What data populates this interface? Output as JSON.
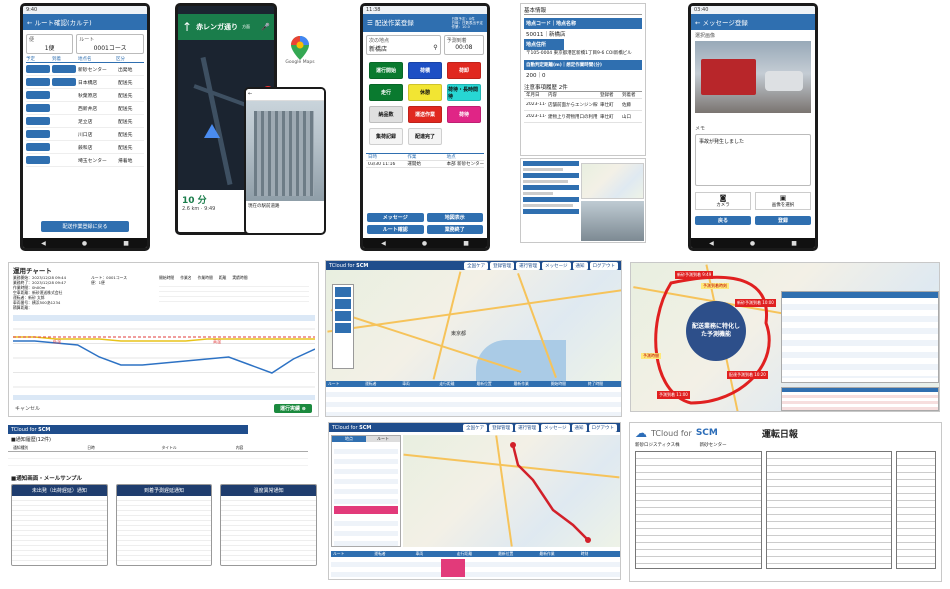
{
  "route_phone": {
    "time": "9:40",
    "title": "ルート確認(カルテ)",
    "bin_label": "便",
    "bin_value": "1便",
    "route_label": "ルート",
    "route_value": "0001コース",
    "col_headers": [
      "予定",
      "到着",
      "地点名",
      "区分"
    ],
    "rows": [
      [
        "新砂センター",
        "出発地"
      ],
      [
        "日本橋店",
        "配送先"
      ],
      [
        "秋葉原店",
        "配送先"
      ],
      [
        "西新井店",
        "配送先"
      ],
      [
        "足立店",
        "配送先"
      ],
      [
        "川口店",
        "配送先"
      ],
      [
        "蕨和店",
        "配送先"
      ],
      [
        "埼玉センター",
        "帰着地"
      ]
    ],
    "return_button": "配送作業登録に戻る"
  },
  "nav_phone": {
    "street": "赤レンガ通り",
    "street_suffix": "方面",
    "eta_minutes": "10 分",
    "distance": "2.6 km · 9:49",
    "dest_label": "現在の駅前道路",
    "google_maps": "Google Maps"
  },
  "work_phone": {
    "time": "11:38",
    "title": "配送作業登録",
    "info": [
      "日数予定：0件",
      "日時：日数表出予定",
      "作業：10.0"
    ],
    "next_point_label": "次の地点",
    "next_point_value": "新橋店",
    "arrival_label": "予測到着",
    "arrival_value": "00:08",
    "buttons": [
      {
        "label": "運行開始",
        "bg": "#0a7a2f"
      },
      {
        "label": "荷積",
        "bg": "#1d4fc4"
      },
      {
        "label": "荷卸",
        "bg": "#e0281f"
      },
      {
        "label": "走行",
        "bg": "#0a7a2f"
      },
      {
        "label": "休憩",
        "bg": "#f2e533"
      },
      {
        "label": "荷待・長時間待",
        "bg": "#27d6d3"
      },
      {
        "label": "納品数",
        "bg": "#e0e0e0"
      },
      {
        "label": "運送作業",
        "bg": "#e0281f"
      },
      {
        "label": "荷待",
        "bg": "#e02586"
      },
      {
        "label": "集荷記録",
        "bg": "#f4f4f4"
      },
      {
        "label": "配達完了",
        "bg": "#f4f4f4"
      }
    ],
    "log_headers": [
      "日時",
      "作業",
      "地点"
    ],
    "log_row": [
      "03/30 11:16",
      "運開始",
      "本部 新砂センター"
    ],
    "bottom_buttons": [
      "メッセージ",
      "地図表示",
      "ルート確認",
      "業務終了"
    ]
  },
  "point_panel": {
    "section": "基本情報",
    "code_label": "地点コード｜地点名称",
    "code_value": "50011｜新橋店",
    "addr_label": "地点住所",
    "addr_value": "〒105-0004 東京都港区新橋1丁目9-6 COI新橋ビル",
    "dist_label": "自動判定距離(m)｜想定作業時間(分)",
    "dist_value": "200｜0",
    "history_label": "注意事項履歴 2件",
    "history_headers": [
      "年月日",
      "内容",
      "登録者",
      "到着者"
    ],
    "history_rows": [
      [
        "2023-11-",
        "店舗前面からエンジン稼働停止要",
        "車仕町",
        "佐藤"
      ],
      [
        "2023-11-",
        "建物上り荷物用口の利用法",
        "車仕町",
        "山口"
      ]
    ]
  },
  "msg_phone": {
    "time": "03:40",
    "title": "メッセージ登録",
    "image_label": "選択画像",
    "memo_label": "メモ",
    "memo_text": "事故が発生しました",
    "camera": "カメラ",
    "gallery": "画像を選択",
    "back": "戻る",
    "register": "登録"
  },
  "operation_chart": {
    "title": "運用チャート",
    "info_rows": [
      [
        "業務開始：2023/12/28 09:44",
        "ルート：0001コース"
      ],
      [
        "業務終了：2023/12/28 09:47",
        "便：1便"
      ],
      [
        "作業時間：0h00m",
        ""
      ],
      [
        "空車距離：新砂運送株式会社",
        ""
      ],
      [
        "運転者：新砂 太郎",
        ""
      ],
      [
        "車両番号：横浜500あ1234",
        ""
      ],
      [
        "積算距離：",
        ""
      ]
    ],
    "right_headers": [
      "開始時間",
      "作業名",
      "作業時間",
      "距離",
      "実績時間"
    ],
    "cancel": "キャンセル",
    "confirm": "運行実績 ⊕",
    "low_label": "低温",
    "high_label": "高温",
    "chart_data": {
      "type": "line",
      "title": "",
      "xlabel": "",
      "ylabel": "",
      "series": [
        {
          "name": "",
          "color": "#e8c41a",
          "values": [
            58,
            58,
            57,
            57,
            57,
            56,
            56,
            56,
            56,
            57,
            57,
            57,
            57,
            57,
            57
          ]
        },
        {
          "name": "",
          "color": "#2d72c4",
          "values": [
            56,
            56,
            55,
            54,
            48,
            44,
            44,
            45,
            46,
            47,
            48,
            44,
            40,
            47,
            52
          ]
        },
        {
          "name": "",
          "color": "#e23b3b",
          "values": [
            58,
            58,
            58,
            58,
            58,
            58,
            58,
            58,
            58,
            58,
            58,
            58,
            58,
            58,
            58
          ]
        }
      ],
      "ylim": [
        30,
        65
      ]
    }
  },
  "map_screen": {
    "brand": "TCloud for",
    "brand_accent": "SCM",
    "toolbar": [
      "全国ケア",
      "登録管理",
      "運行管理",
      "メッセージ",
      "通知",
      "ログアウト"
    ],
    "center_label": "東京都",
    "table_headers": [
      "ルート",
      "運転者",
      "車両",
      "走行距離",
      "最新位置",
      "最新作業",
      "開始時間",
      "終了時間"
    ]
  },
  "route_map": {
    "center_title": "配送業務に特化した予測機能",
    "pins": [
      "新砂予測到着 9:49",
      "新砂予測到着 10:00",
      "配達予測到着 10:20",
      "予測到着 11:00"
    ],
    "callouts": [
      "予測到着時刻",
      "予測時間"
    ]
  },
  "notify_screen": {
    "brand": "TCloud for",
    "brand_accent": "SCM",
    "list_title": "■通知履歴(12件)",
    "columns": [
      "通知種別",
      "日時",
      "タイトル",
      "内容"
    ],
    "samples_title": "■通知画面・メールサンプル",
    "cards": [
      "未出発（出荷遅延）通知",
      "到着予測遅延通知",
      "温度異常通知"
    ]
  },
  "track_screen": {
    "brand": "TCloud for",
    "brand_accent": "SCM",
    "toolbar": [
      "全国ケア",
      "登録管理",
      "運行管理",
      "メッセージ",
      "通知",
      "ログアウト"
    ],
    "tabs": [
      "地点",
      "ルート"
    ],
    "table_headers": [
      "ルート",
      "運転者",
      "車両",
      "走行距離",
      "最新位置",
      "最新作業",
      "時刻"
    ]
  },
  "daily_report": {
    "brand": "TCloud for",
    "brand_accent": "SCM",
    "title": "運転日報",
    "company": "新砂ロジスティクス株",
    "center": "新砂センター"
  }
}
